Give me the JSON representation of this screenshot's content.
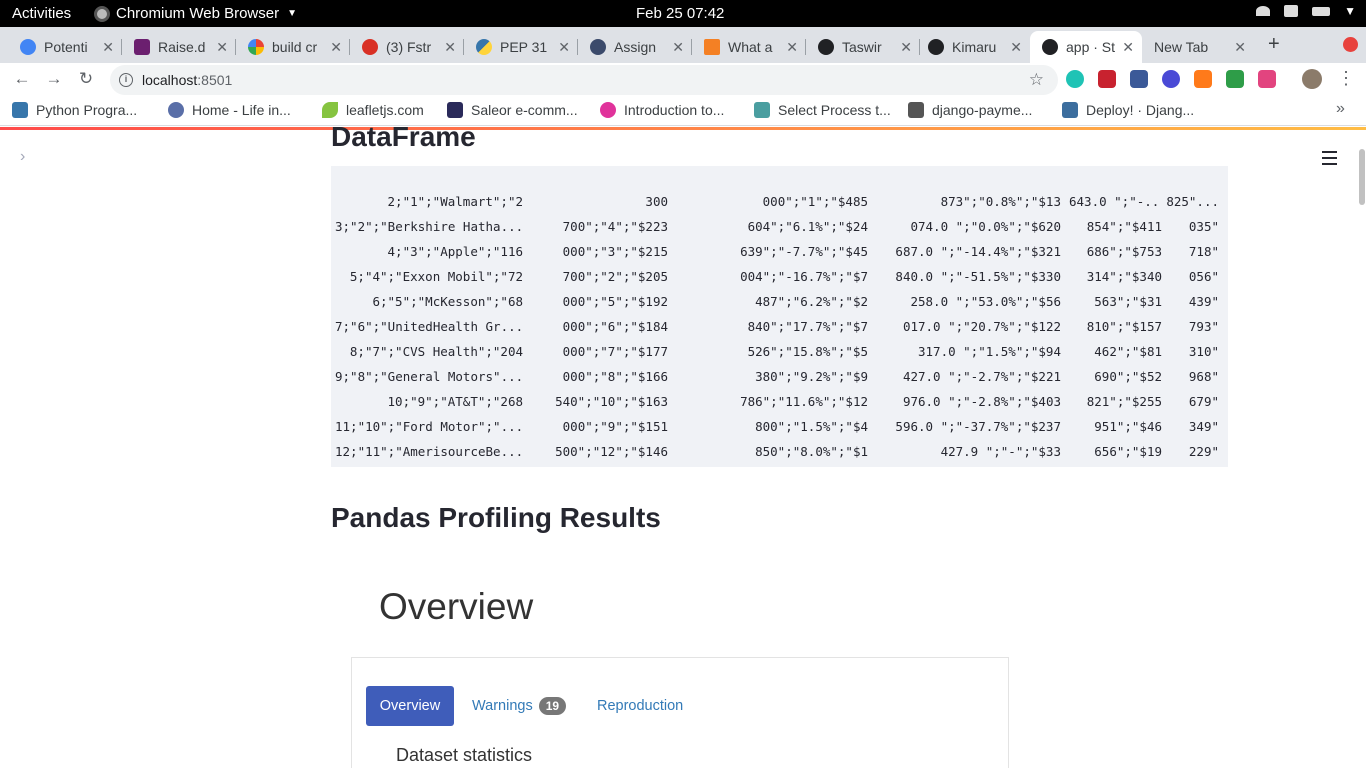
{
  "system": {
    "activities": "Activities",
    "app_name": "Chromium Web Browser",
    "clock": "Feb 25  07:42"
  },
  "tabs": [
    {
      "title": "Potenti",
      "color": "#4285f4"
    },
    {
      "title": "Raise.d",
      "color": "#6b1f6f"
    },
    {
      "title": "build cr",
      "color": "#4285f4"
    },
    {
      "title": "(3) Fstr",
      "color": "#d93025"
    },
    {
      "title": "PEP 31",
      "color": "#3776ab"
    },
    {
      "title": "Assign",
      "color": "#3b4a6b"
    },
    {
      "title": "What a",
      "color": "#f48024"
    },
    {
      "title": "Taswir",
      "color": "#202124"
    },
    {
      "title": "Kimaru",
      "color": "#202124"
    },
    {
      "title": "app · St",
      "color": "#202124"
    },
    {
      "title": "New Tab",
      "color": "#dee1e6"
    }
  ],
  "address": {
    "host": "localhost",
    "port": ":8501"
  },
  "bookmarks": [
    {
      "label": "Python Progra...",
      "color": "#3776ab"
    },
    {
      "label": "Home - Life in...",
      "color": "#5a6fa8"
    },
    {
      "label": "leafletjs.com",
      "color": "#86c440"
    },
    {
      "label": "Saleor e-comm...",
      "color": "#2a2a5a"
    },
    {
      "label": "Introduction to...",
      "color": "#e0339b"
    },
    {
      "label": "Select Process t...",
      "color": "#4a9ea0"
    },
    {
      "label": "django-payme...",
      "color": "#555555"
    },
    {
      "label": "Deploy! · Djang...",
      "color": "#3c6e9e"
    }
  ],
  "main": {
    "dataframe_title": "DataFrame",
    "dataframe_rows": [
      [
        "2;\"1\";\"Walmart\";\"2",
        "300",
        "000\";\"1\";\"$485",
        "873\";\"0.8%\";\"$13",
        "643.0 \";\"-...",
        "825\"..."
      ],
      [
        "3;\"2\";\"Berkshire Hatha...",
        "700\";\"4\";\"$223",
        "604\";\"6.1%\";\"$24",
        "074.0 \";\"0.0%\";\"$620",
        "854\";\"$411",
        "035\""
      ],
      [
        "4;\"3\";\"Apple\";\"116",
        "000\";\"3\";\"$215",
        "639\";\"-7.7%\";\"$45",
        "687.0 \";\"-14.4%\";\"$321",
        "686\";\"$753",
        "718\""
      ],
      [
        "5;\"4\";\"Exxon Mobil\";\"72",
        "700\";\"2\";\"$205",
        "004\";\"-16.7%\";\"$7",
        "840.0 \";\"-51.5%\";\"$330",
        "314\";\"$340",
        "056\""
      ],
      [
        "6;\"5\";\"McKesson\";\"68",
        "000\";\"5\";\"$192",
        "487\";\"6.2%\";\"$2",
        "258.0 \";\"53.0%\";\"$56",
        "563\";\"$31",
        "439\""
      ],
      [
        "7;\"6\";\"UnitedHealth Gr...",
        "000\";\"6\";\"$184",
        "840\";\"17.7%\";\"$7",
        "017.0 \";\"20.7%\";\"$122",
        "810\";\"$157",
        "793\""
      ],
      [
        "8;\"7\";\"CVS Health\";\"204",
        "000\";\"7\";\"$177",
        "526\";\"15.8%\";\"$5",
        "317.0 \";\"1.5%\";\"$94",
        "462\";\"$81",
        "310\""
      ],
      [
        "9;\"8\";\"General Motors\"...",
        "000\";\"8\";\"$166",
        "380\";\"9.2%\";\"$9",
        "427.0 \";\"-2.7%\";\"$221",
        "690\";\"$52",
        "968\""
      ],
      [
        "10;\"9\";\"AT&T\";\"268",
        "540\";\"10\";\"$163",
        "786\";\"11.6%\";\"$12",
        "976.0 \";\"-2.8%\";\"$403",
        "821\";\"$255",
        "679\""
      ],
      [
        "11;\"10\";\"Ford Motor\";\"...",
        "000\";\"9\";\"$151",
        "800\";\"1.5%\";\"$4",
        "596.0 \";\"-37.7%\";\"$237",
        "951\";\"$46",
        "349\""
      ],
      [
        "12;\"11\";\"AmerisourceBe...",
        "500\";\"12\";\"$146",
        "850\";\"8.0%\";\"$1",
        "427.9 \";\"-\";\"$33",
        "656\";\"$19",
        "229\""
      ]
    ],
    "profiling_title": "Pandas Profiling Results",
    "overview_heading": "Overview",
    "tabs": {
      "overview": "Overview",
      "warnings": "Warnings",
      "warnings_count": "19",
      "reproduction": "Reproduction"
    },
    "dataset_statistics": "Dataset statistics"
  },
  "colors": {
    "accent": "#3f5dba",
    "streamlit_red": "#ff4b4b"
  }
}
